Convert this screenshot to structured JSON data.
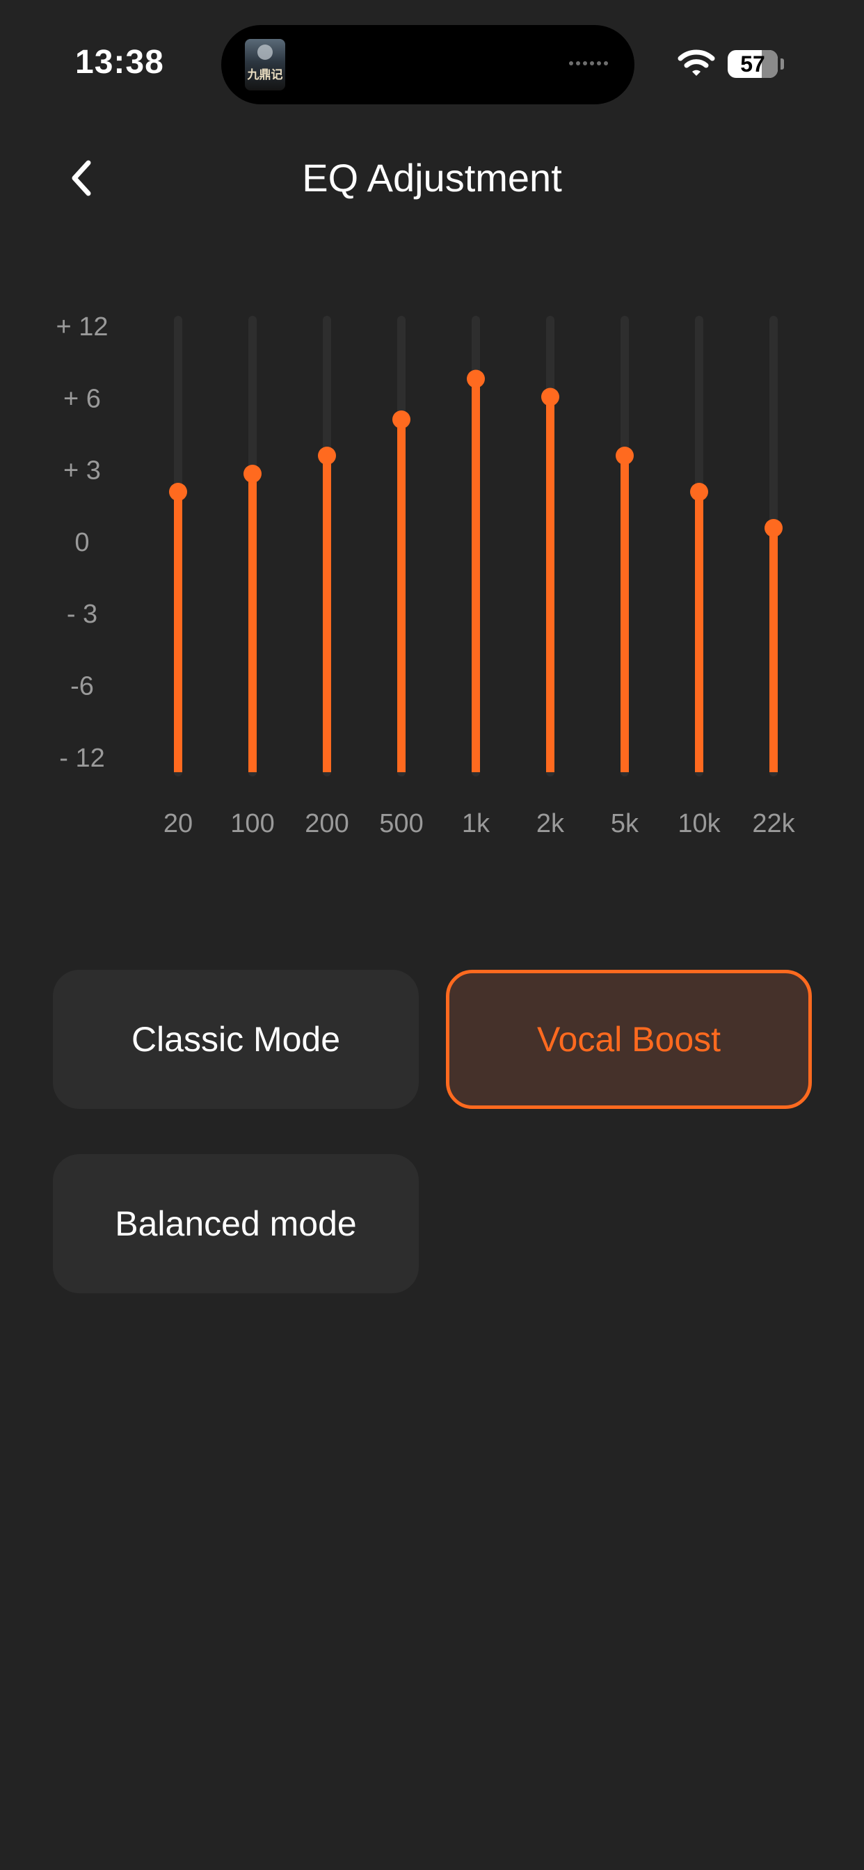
{
  "status_bar": {
    "time": "13:38",
    "now_playing_art_text": "九鼎记",
    "battery_level": "57",
    "icons": [
      "wifi-icon",
      "battery-icon"
    ]
  },
  "header": {
    "title": "EQ Adjustment",
    "back_icon": "chevron-left-icon"
  },
  "colors": {
    "background": "#232323",
    "accent": "#ff6a1f",
    "track": "#2e2e2e",
    "button_bg": "#2d2d2d",
    "button_selected_bg": "#45312a"
  },
  "chart_data": {
    "type": "bar",
    "y_tick_labels": [
      "+ 12",
      "+ 6",
      "+ 3",
      "0",
      "- 3",
      "-6",
      "- 12"
    ],
    "categories": [
      "20",
      "100",
      "200",
      "500",
      "1k",
      "2k",
      "5k",
      "10k",
      "22k"
    ],
    "y_position_fraction": [
      0.62,
      0.66,
      0.7,
      0.78,
      0.87,
      0.83,
      0.7,
      0.62,
      0.54
    ],
    "grid": false
  },
  "modes": [
    {
      "label": "Classic Mode",
      "selected": false
    },
    {
      "label": "Vocal Boost",
      "selected": true
    },
    {
      "label": "Balanced mode",
      "selected": false
    }
  ]
}
